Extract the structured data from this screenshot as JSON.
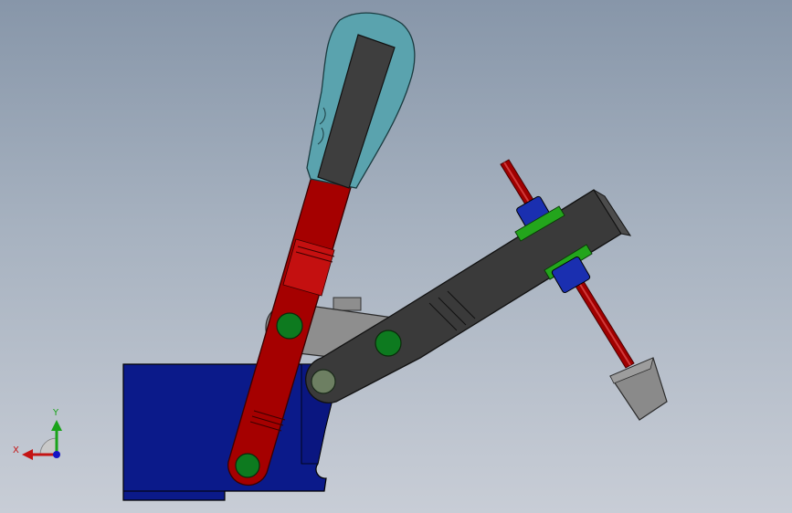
{
  "scene": {
    "parts": [
      {
        "name": "base-block",
        "color": "#0b1a8a"
      },
      {
        "name": "hand-lever",
        "color": "#a50000"
      },
      {
        "name": "grip-handle",
        "color": "#5aa3ae"
      },
      {
        "name": "clamp-arm",
        "color": "#3a3a3a"
      },
      {
        "name": "link-plate",
        "color": "#8e8e8e"
      },
      {
        "name": "pivot-pin",
        "color": "#0d7a1f"
      },
      {
        "name": "spindle-rod",
        "color": "#9e0000"
      },
      {
        "name": "hex-nut",
        "color": "#1a2fb0"
      },
      {
        "name": "flange-washer",
        "color": "#23a51c"
      },
      {
        "name": "rubber-tip",
        "color": "#8a8a8a"
      }
    ]
  },
  "triad": {
    "y_label": "Y",
    "x_label": "X",
    "y_color": "#1aa31a",
    "x_color": "#c41414",
    "z_color": "#1414c4"
  }
}
